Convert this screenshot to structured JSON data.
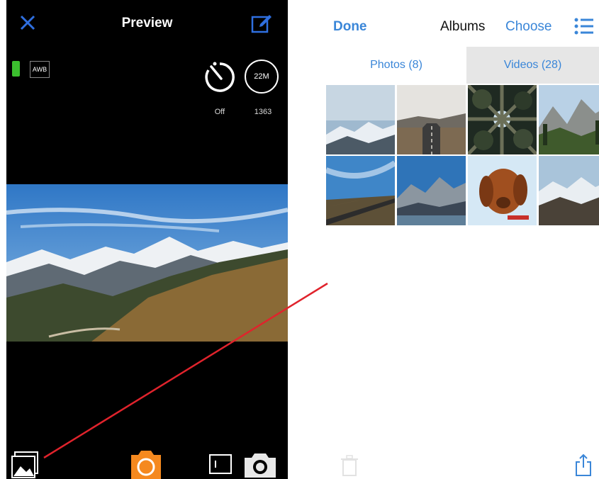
{
  "preview_screen": {
    "title": "Preview",
    "close_icon": "close-icon",
    "edit_icon": "edit-icon",
    "status": {
      "awb_label": "AWB",
      "battery_color": "#3bbf2e",
      "timer_state": "Off",
      "resolution": "22M",
      "remaining_count": "1363"
    },
    "bottom_bar": {
      "gallery_icon": "gallery-icon",
      "shutter_color": "#f5891f",
      "video_mode_icon": "video-mode-icon",
      "photo_mode_icon": "camera-icon"
    }
  },
  "album_screen": {
    "done_label": "Done",
    "title": "Albums",
    "choose_label": "Choose",
    "list_icon": "list-icon",
    "tabs": [
      {
        "label": "Photos (8)",
        "selected": true
      },
      {
        "label": "Videos (28)",
        "selected": false
      }
    ],
    "thumbnails": [
      {
        "subject": "snowy mountain range"
      },
      {
        "subject": "empty road"
      },
      {
        "subject": "forest canopy from below"
      },
      {
        "subject": "valley with cliffs"
      },
      {
        "subject": "desert highway"
      },
      {
        "subject": "mountain lake"
      },
      {
        "subject": "brown dog"
      },
      {
        "subject": "mountain ridge"
      }
    ],
    "trash_icon": "trash-icon",
    "share_icon": "share-icon"
  },
  "colors": {
    "accent": "#3a86d8",
    "annotation_line": "#e0232c"
  }
}
